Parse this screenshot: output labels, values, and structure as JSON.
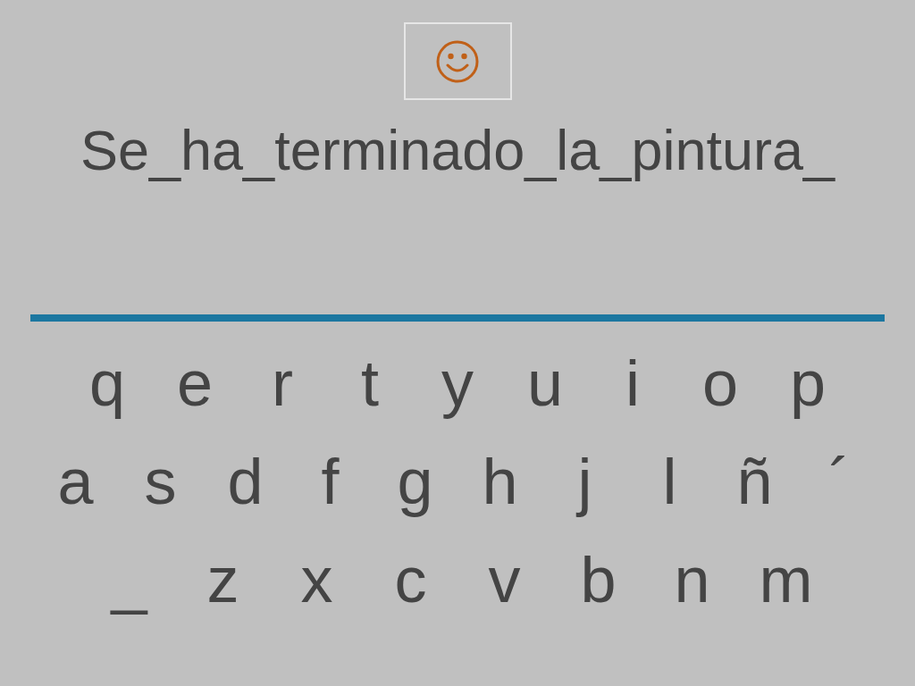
{
  "phrase": "Se_ha_terminado_la_pintura_",
  "keyboard": [
    [
      "q",
      "e",
      "r",
      "t",
      "y",
      "u",
      "i",
      "o",
      "p"
    ],
    [
      "a",
      "s",
      "d",
      "f",
      "g",
      "h",
      "j",
      "l",
      "ñ",
      "´"
    ],
    [
      "_",
      "z",
      "x",
      "c",
      "v",
      "b",
      "n",
      "m"
    ]
  ]
}
